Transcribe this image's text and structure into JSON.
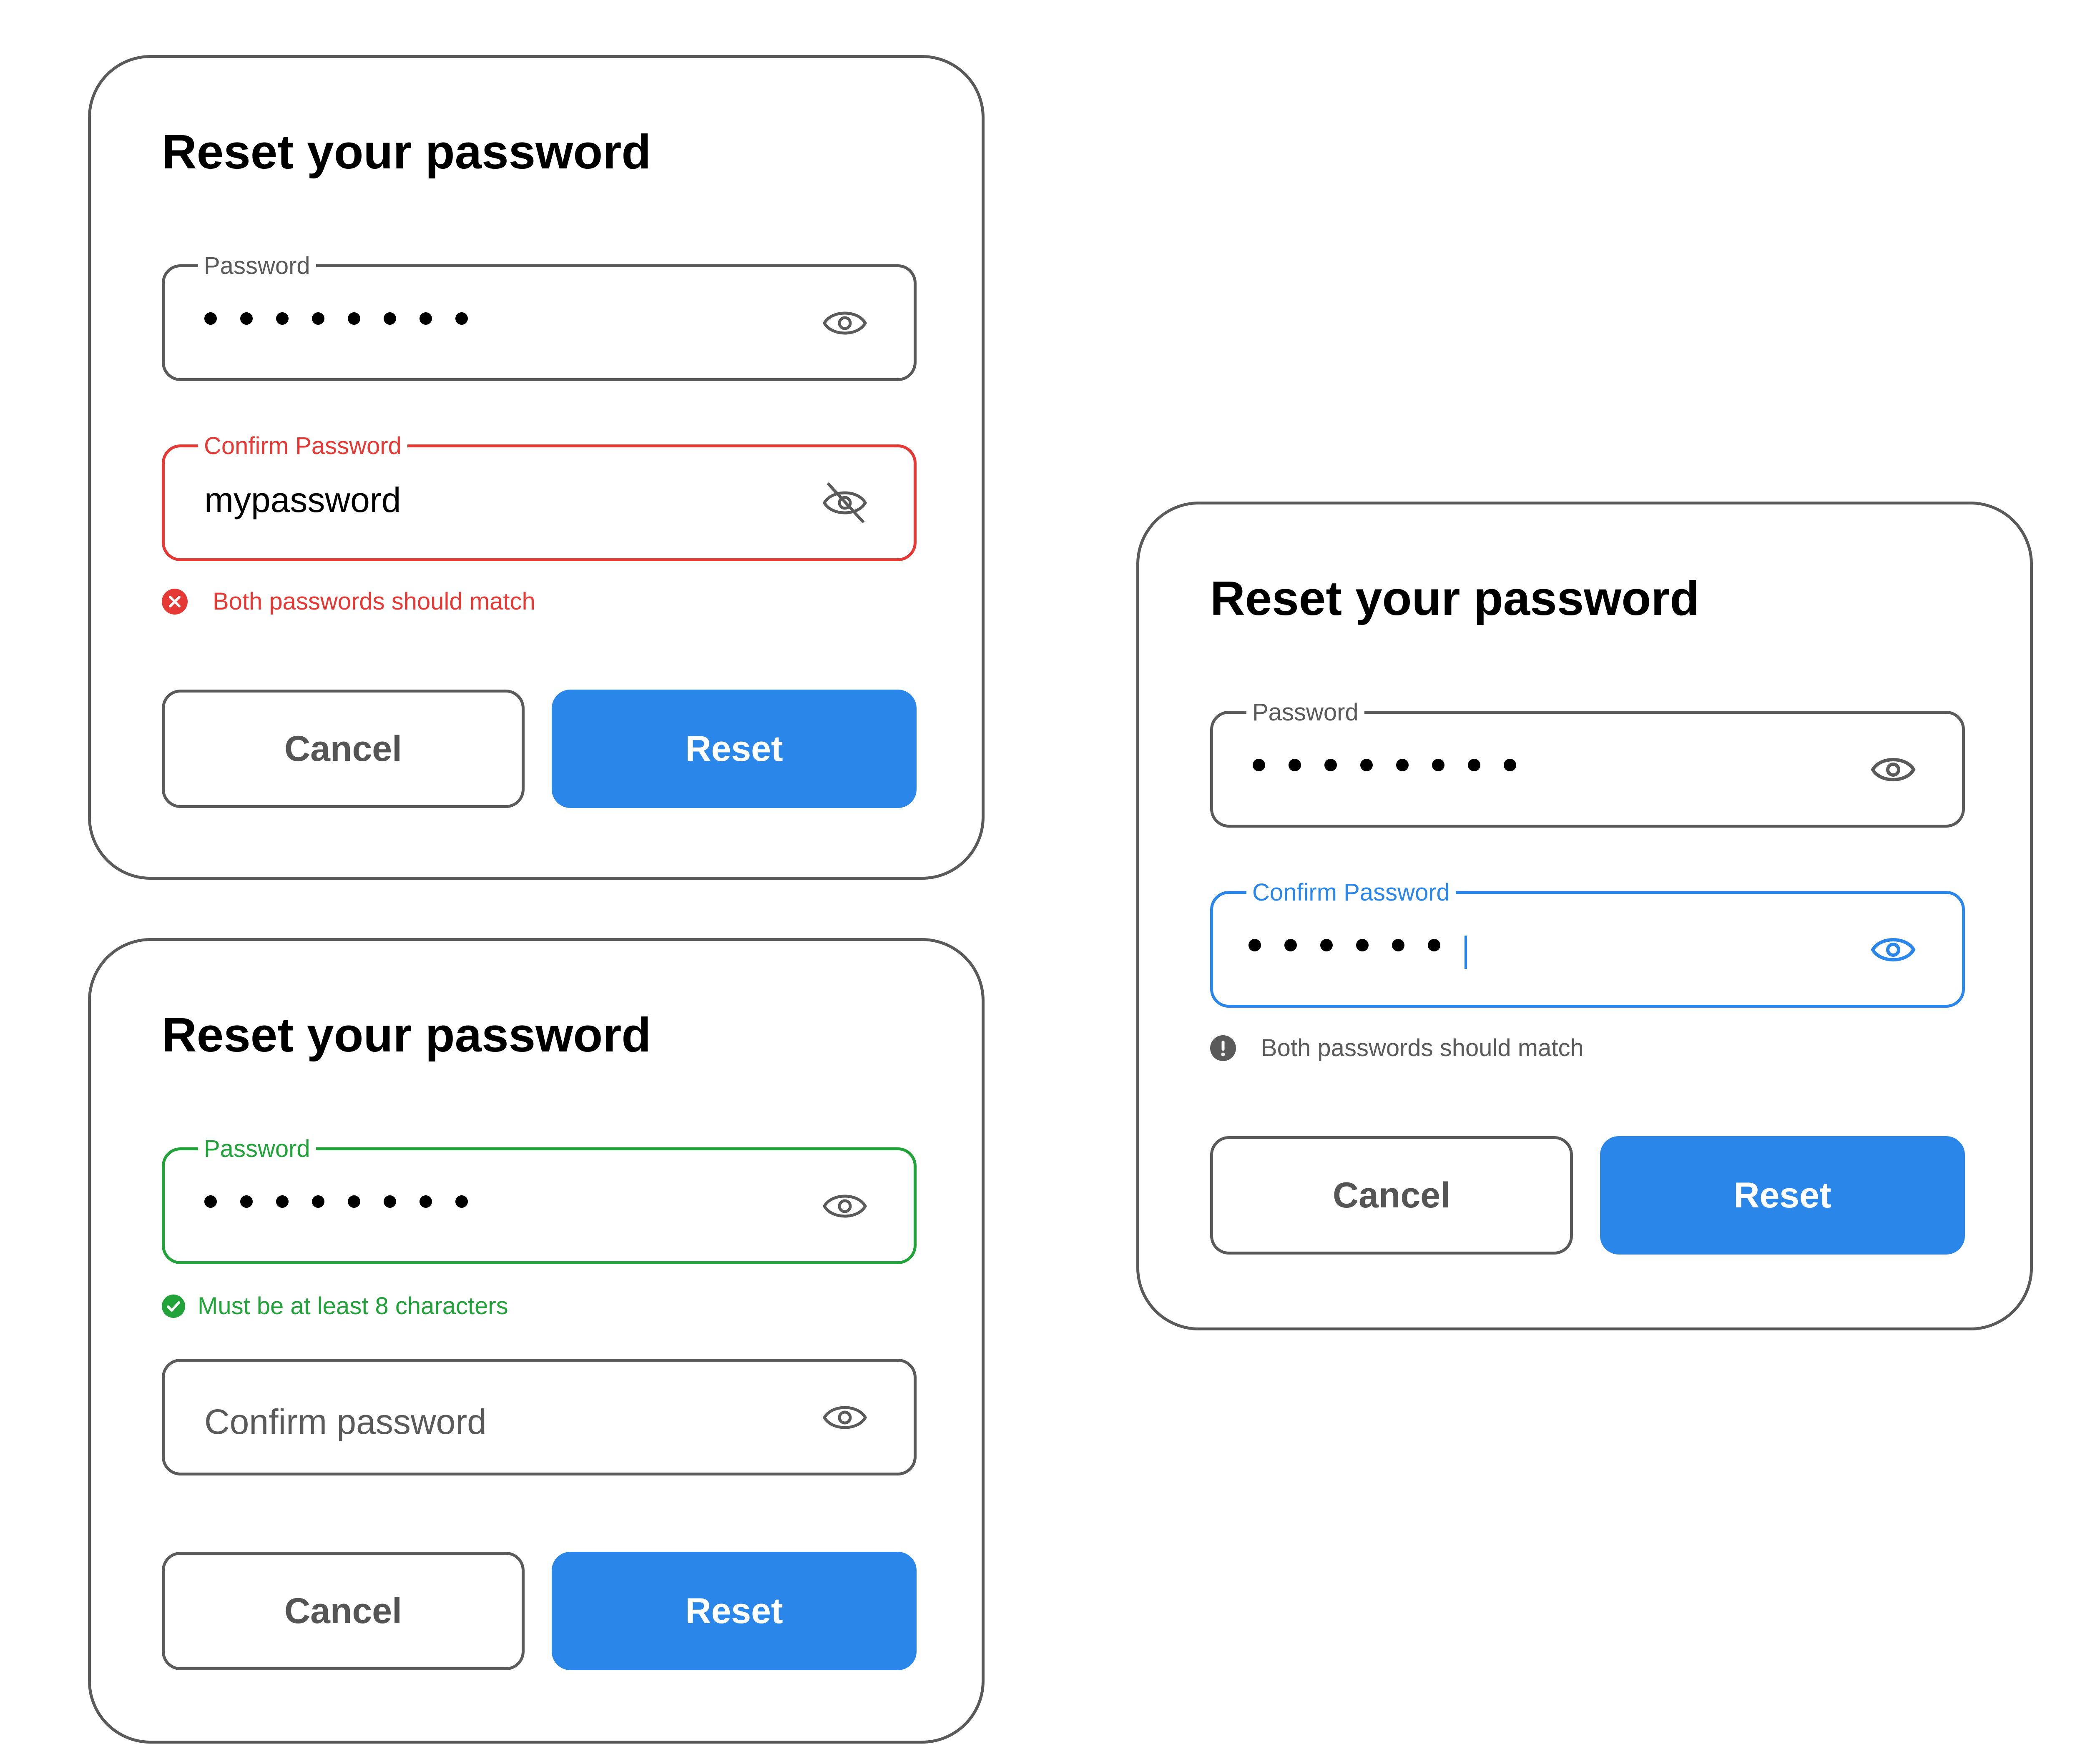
{
  "colors": {
    "primary": "#2a86e8",
    "error": "#e53935",
    "success": "#22a33a",
    "border": "#5a5a5a"
  },
  "card1": {
    "title": "Reset your password",
    "password": {
      "label": "Password",
      "masked_length": 8,
      "icon": "eye-icon"
    },
    "confirm": {
      "label": "Confirm Password",
      "value": "mypassword",
      "icon": "eye-off-icon",
      "state": "error"
    },
    "error_message": "Both passwords should match",
    "cancel_label": "Cancel",
    "reset_label": "Reset"
  },
  "card2": {
    "title": "Reset your password",
    "password": {
      "label": "Password",
      "masked_length": 8,
      "icon": "eye-icon",
      "state": "success"
    },
    "hint_message": "Must be at least 8 characters",
    "confirm": {
      "placeholder": "Confirm password",
      "icon": "eye-icon"
    },
    "cancel_label": "Cancel",
    "reset_label": "Reset"
  },
  "card3": {
    "title": "Reset your password",
    "password": {
      "label": "Password",
      "masked_length": 8,
      "icon": "eye-icon"
    },
    "confirm": {
      "label": "Confirm Password",
      "masked_length": 6,
      "icon": "eye-icon",
      "state": "focused"
    },
    "info_message": "Both passwords should match",
    "cancel_label": "Cancel",
    "reset_label": "Reset"
  }
}
